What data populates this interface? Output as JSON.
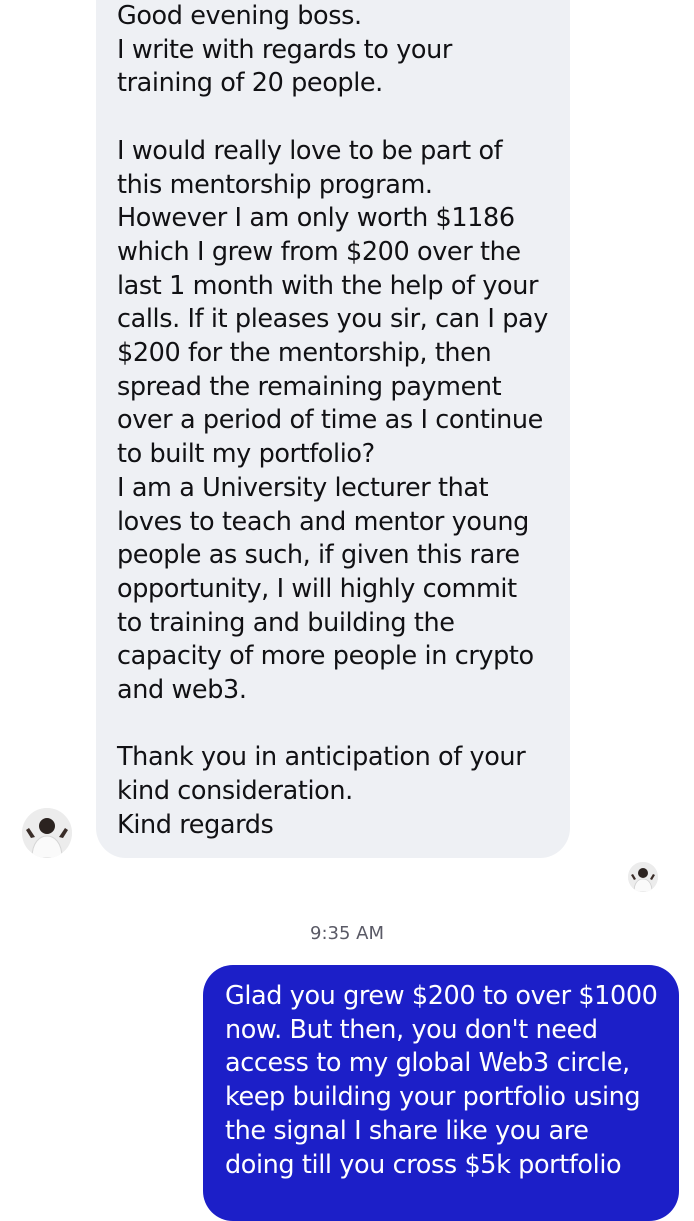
{
  "conversation": {
    "incoming_message": {
      "text": "Good evening boss.\nI write with regards to your\ntraining of 20 people.\n\nI would really love to be part of\nthis mentorship program.\nHowever I am only worth $1186\nwhich I grew from $200 over the\nlast 1 month with the help of your\ncalls. If it pleases you sir, can I pay\n$200 for the mentorship, then\nspread the remaining payment\nover a period of time as I continue\nto built my portfolio?\nI am a University lecturer that\nloves to teach and mentor young\npeople as such, if given this rare\nopportunity, I will highly commit\nto training and building the\ncapacity of more people in crypto\nand web3.\n\nThank you in anticipation of your\nkind consideration.\nKind regards"
    },
    "timestamp": "9:35 AM",
    "outgoing_message": {
      "text": "Glad you grew $200 to over $1000\nnow. But then, you don't need\naccess to my global Web3 circle,\nkeep building your portfolio using\nthe signal I share like you are\ndoing till you cross $5k portfolio"
    }
  },
  "colors": {
    "incoming_bubble": "#eef0f4",
    "outgoing_bubble": "#1c1fc8",
    "background": "#ffffff",
    "timestamp_text": "#5a5a66"
  },
  "icons": {
    "sender_avatar": "user-avatar",
    "read_receipt_avatar": "user-avatar-small"
  }
}
